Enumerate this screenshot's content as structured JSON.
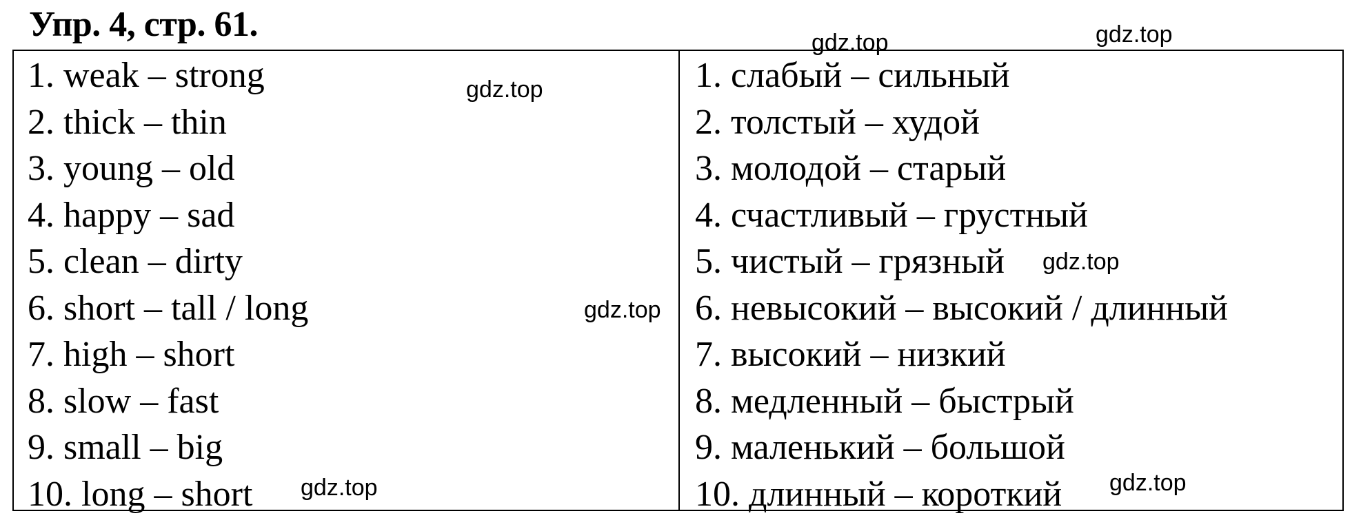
{
  "title": "Упр. 4, стр. 61.",
  "table": {
    "left_column": [
      "1. weak – strong",
      "2. thick – thin",
      "3. young – old",
      "4. happy – sad",
      "5. clean – dirty",
      "6. short – tall / long",
      "7. high – short",
      "8. slow – fast",
      "9. small – big",
      "10. long – short"
    ],
    "right_column": [
      "1. слабый – сильный",
      "2. толстый – худой",
      "3. молодой – старый",
      "4. счастливый – грустный",
      "5. чистый – грязный",
      "6. невысокий – высокий / длинный",
      "7. высокий – низкий",
      "8. медленный – быстрый",
      "9. маленький – большой",
      "10. длинный – короткий"
    ]
  },
  "watermark": "gdz.top"
}
